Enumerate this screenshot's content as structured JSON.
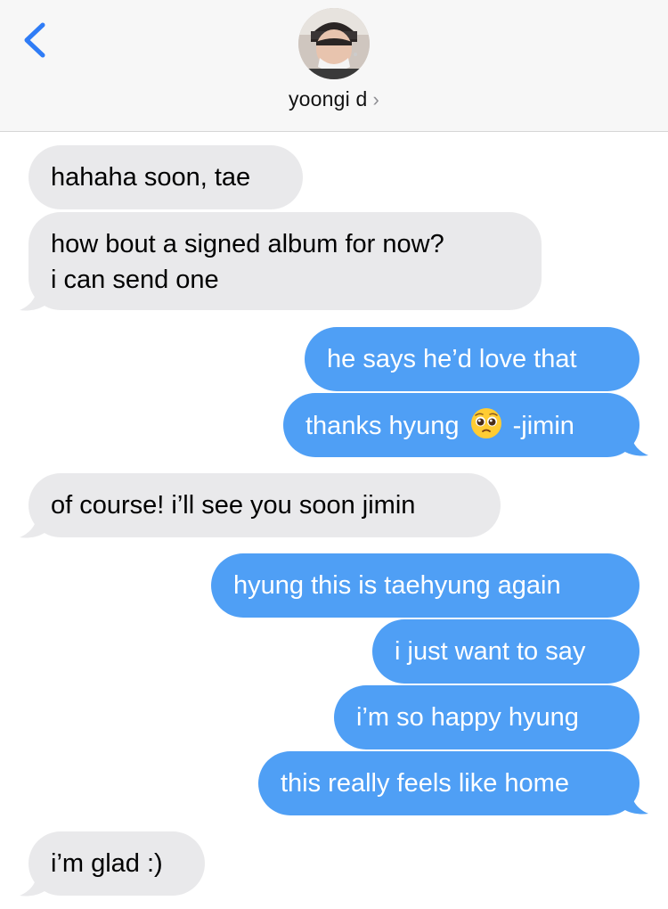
{
  "header": {
    "contact_name": "yoongi d",
    "chevron": "›",
    "back_icon": "chevron-left-icon",
    "accent_color": "#2f7cf6"
  },
  "messages": [
    {
      "side": "incoming",
      "text": "hahaha soon, tae"
    },
    {
      "side": "incoming",
      "line1": "how bout a signed album for now?",
      "line2": "i can send one"
    },
    {
      "side": "outgoing",
      "text": "he says he’d love that"
    },
    {
      "side": "outgoing",
      "text_before": "thanks hyung",
      "emoji": "pleading-face-emoji",
      "text_after": "-jimin"
    },
    {
      "side": "incoming",
      "text": "of course! i’ll see you soon jimin"
    },
    {
      "side": "outgoing",
      "text": "hyung this is taehyung again"
    },
    {
      "side": "outgoing",
      "text": "i just want to say"
    },
    {
      "side": "outgoing",
      "text": "i’m so happy hyung"
    },
    {
      "side": "outgoing",
      "text": "this really feels like home"
    },
    {
      "side": "incoming",
      "text": "i’m glad :)"
    }
  ],
  "colors": {
    "incoming_bubble": "#e9e9eb",
    "outgoing_bubble": "#4f9ff5",
    "header_bg": "#f7f7f7"
  }
}
